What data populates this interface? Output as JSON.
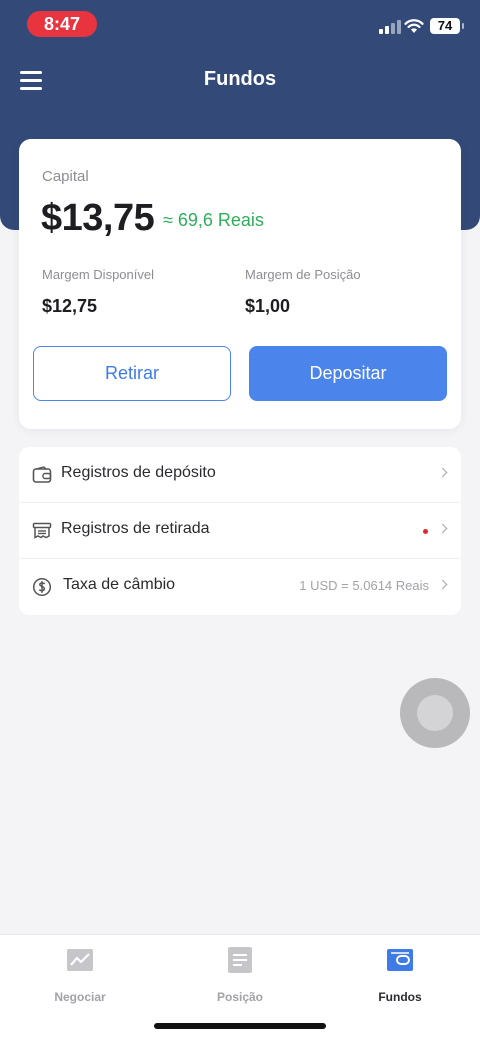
{
  "status_bar": {
    "time": "8:47",
    "battery": "74"
  },
  "nav": {
    "title": "Fundos",
    "menu_icon": "hamburger-menu-icon"
  },
  "capital": {
    "label": "Capital",
    "value": "$13,75",
    "approx": "≈ 69,6 Reais",
    "available_margin_label": "Margem Disponível",
    "available_margin_value": "$12,75",
    "position_margin_label": "Margem de Posição",
    "position_margin_value": "$1,00",
    "withdraw_label": "Retirar",
    "deposit_label": "Depositar"
  },
  "records": [
    {
      "label": "Registros de depósito",
      "icon": "wallet-icon"
    },
    {
      "label": "Registros de retirada",
      "icon": "receipt-icon"
    },
    {
      "label": "Taxa de câmbio",
      "icon": "dollar-exchange-icon",
      "value": "1 USD = 5.0614 Reais"
    }
  ],
  "tabs": [
    {
      "label": "Negociar",
      "icon": "chart-icon",
      "active": false
    },
    {
      "label": "Posição",
      "icon": "document-icon",
      "active": false
    },
    {
      "label": "Fundos",
      "icon": "wallet-icon",
      "active": true
    }
  ],
  "colors": {
    "header": "#334a78",
    "accent": "#4b84ea",
    "positive": "#2fae5b",
    "alert_dot": "#e02b2b"
  }
}
